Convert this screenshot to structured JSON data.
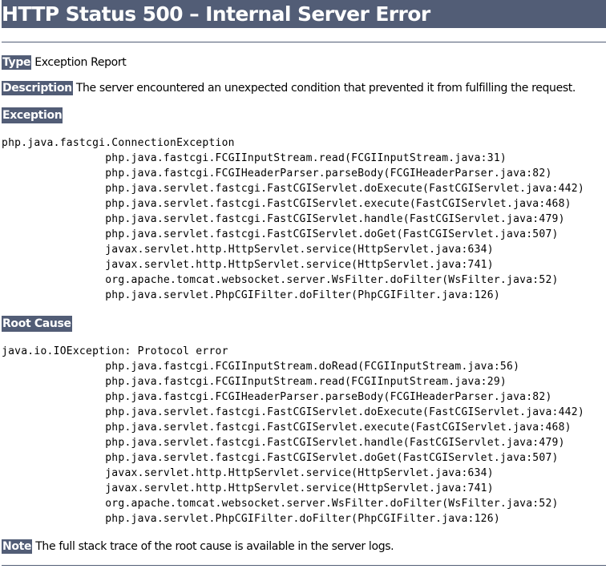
{
  "title": "HTTP Status 500 – Internal Server Error",
  "type": {
    "label": "Type",
    "value": "Exception Report"
  },
  "description": {
    "label": "Description",
    "value": "The server encountered an unexpected condition that prevented it from fulfilling the request."
  },
  "exception": {
    "heading": "Exception",
    "first_line": "php.java.fastcgi.ConnectionException",
    "frames": [
      "php.java.fastcgi.FCGIInputStream.read(FCGIInputStream.java:31)",
      "php.java.fastcgi.FCGIHeaderParser.parseBody(FCGIHeaderParser.java:82)",
      "php.java.servlet.fastcgi.FastCGIServlet.doExecute(FastCGIServlet.java:442)",
      "php.java.servlet.fastcgi.FastCGIServlet.execute(FastCGIServlet.java:468)",
      "php.java.servlet.fastcgi.FastCGIServlet.handle(FastCGIServlet.java:479)",
      "php.java.servlet.fastcgi.FastCGIServlet.doGet(FastCGIServlet.java:507)",
      "javax.servlet.http.HttpServlet.service(HttpServlet.java:634)",
      "javax.servlet.http.HttpServlet.service(HttpServlet.java:741)",
      "org.apache.tomcat.websocket.server.WsFilter.doFilter(WsFilter.java:52)",
      "php.java.servlet.PhpCGIFilter.doFilter(PhpCGIFilter.java:126)"
    ]
  },
  "root_cause": {
    "heading": "Root Cause",
    "first_line": "java.io.IOException: Protocol error",
    "frames": [
      "php.java.fastcgi.FCGIInputStream.doRead(FCGIInputStream.java:56)",
      "php.java.fastcgi.FCGIInputStream.read(FCGIInputStream.java:29)",
      "php.java.fastcgi.FCGIHeaderParser.parseBody(FCGIHeaderParser.java:82)",
      "php.java.servlet.fastcgi.FastCGIServlet.doExecute(FastCGIServlet.java:442)",
      "php.java.servlet.fastcgi.FastCGIServlet.execute(FastCGIServlet.java:468)",
      "php.java.servlet.fastcgi.FastCGIServlet.handle(FastCGIServlet.java:479)",
      "php.java.servlet.fastcgi.FastCGIServlet.doGet(FastCGIServlet.java:507)",
      "javax.servlet.http.HttpServlet.service(HttpServlet.java:634)",
      "javax.servlet.http.HttpServlet.service(HttpServlet.java:741)",
      "org.apache.tomcat.websocket.server.WsFilter.doFilter(WsFilter.java:52)",
      "php.java.servlet.PhpCGIFilter.doFilter(PhpCGIFilter.java:126)"
    ]
  },
  "note": {
    "label": "Note",
    "value": "The full stack trace of the root cause is available in the server logs."
  },
  "colors": {
    "accent": "#525d76",
    "background": "#ffffff",
    "text": "#000000"
  }
}
